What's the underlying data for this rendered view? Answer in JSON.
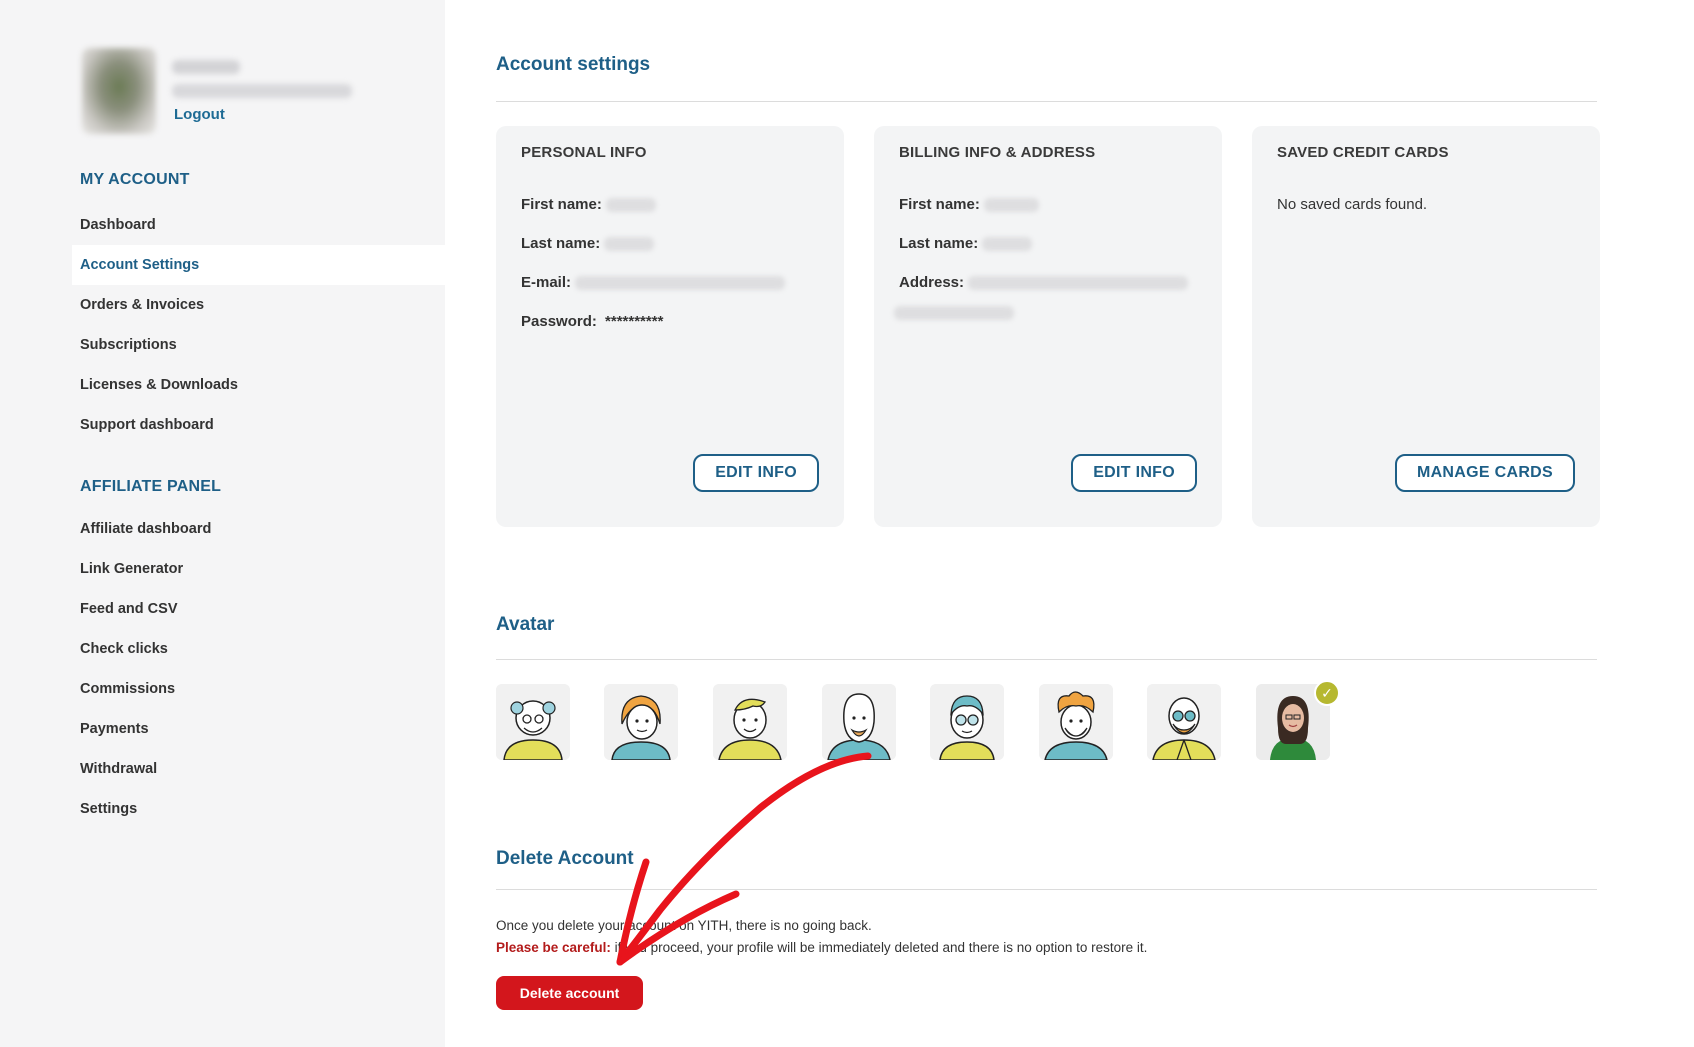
{
  "sidebar": {
    "logout_label": "Logout",
    "my_account_title": "MY ACCOUNT",
    "my_account_items": [
      "Dashboard",
      "Account Settings",
      "Orders & Invoices",
      "Subscriptions",
      "Licenses & Downloads",
      "Support dashboard"
    ],
    "active_item": "Account Settings",
    "affiliate_title": "AFFILIATE PANEL",
    "affiliate_items": [
      "Affiliate dashboard",
      "Link Generator",
      "Feed and CSV",
      "Check clicks",
      "Commissions",
      "Payments",
      "Withdrawal",
      "Settings"
    ]
  },
  "main": {
    "title": "Account settings",
    "personal": {
      "title": "PERSONAL INFO",
      "first_name_label": "First name:",
      "last_name_label": "Last name:",
      "email_label": "E-mail:",
      "password_label": "Password:",
      "password_value": "**********",
      "edit_label": "EDIT INFO"
    },
    "billing": {
      "title": "BILLING INFO & ADDRESS",
      "first_name_label": "First name:",
      "last_name_label": "Last name:",
      "address_label": "Address:",
      "edit_label": "EDIT INFO"
    },
    "cards": {
      "title": "SAVED CREDIT CARDS",
      "empty_text": "No saved cards found.",
      "manage_label": "MANAGE CARDS"
    },
    "avatar_section": {
      "title": "Avatar",
      "selected_index": 7,
      "avatars": [
        "avatar-old-man-icon",
        "avatar-woman-orange-hair-icon",
        "avatar-young-man-icon",
        "avatar-bald-beard-icon",
        "avatar-glasses-woman-icon",
        "avatar-curly-hair-man-icon",
        "avatar-bald-glasses-man-icon",
        "avatar-user-photo"
      ]
    },
    "delete": {
      "title": "Delete Account",
      "line1": "Once you delete your account on YITH, there is no going back.",
      "warn_label": "Please be careful:",
      "line2_rest": " if you proceed, your profile will be immediately deleted and there is no option to restore it.",
      "button_label": "Delete account"
    }
  },
  "colors": {
    "brand_blue": "#1e5f87",
    "danger_red": "#d3161c",
    "selected_check": "#b6b830",
    "annotation_arrow": "#e8141c"
  }
}
